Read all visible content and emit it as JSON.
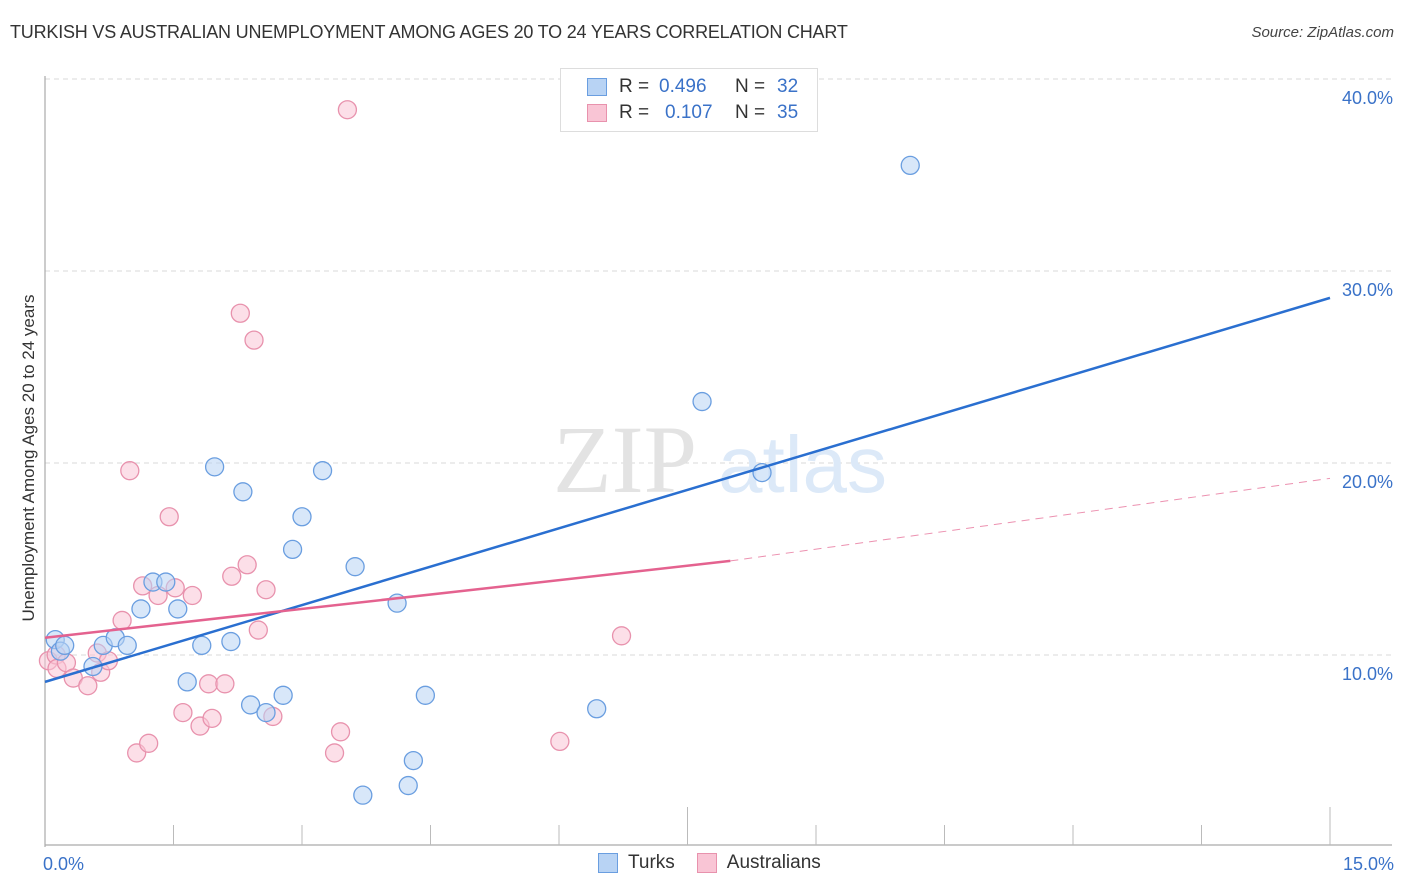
{
  "title": "TURKISH VS AUSTRALIAN UNEMPLOYMENT AMONG AGES 20 TO 24 YEARS CORRELATION CHART",
  "source": "Source: ZipAtlas.com",
  "watermark": {
    "zip": "ZIP",
    "atlas": "atlas"
  },
  "colors": {
    "turks_fill": "#b8d3f4",
    "turks_stroke": "#6a9ee0",
    "turks_line": "#2a6fd0",
    "australians_fill": "#f9c5d5",
    "australians_stroke": "#e892ad",
    "australians_line": "#e4628f",
    "tick_text": "#3a72c8"
  },
  "legend": {
    "rows": [
      {
        "r_label": "R =",
        "r_value": "0.496",
        "n_label": "N =",
        "n_value": "32"
      },
      {
        "r_label": "R =",
        "r_value": "0.107",
        "n_label": "N =",
        "n_value": "35"
      }
    ]
  },
  "bottom_legend": [
    "Turks",
    "Australians"
  ],
  "chart_data": {
    "type": "scatter",
    "title": "TURKISH VS AUSTRALIAN UNEMPLOYMENT AMONG AGES 20 TO 24 YEARS CORRELATION CHART",
    "xlabel": "",
    "ylabel": "Unemployment Among Ages 20 to 24 years",
    "xlim": [
      0,
      15
    ],
    "ylim": [
      0,
      42
    ],
    "x_tick_labels": [
      "0.0%",
      "15.0%"
    ],
    "y_ticks": [
      10,
      20,
      30,
      40
    ],
    "y_tick_labels": [
      "10.0%",
      "20.0%",
      "30.0%",
      "40.0%"
    ],
    "grid": "horizontal-dashed",
    "legend_position": "top-center",
    "series": [
      {
        "name": "Turks",
        "r": 0.496,
        "n": 32,
        "points": [
          [
            0.12,
            10.8
          ],
          [
            0.18,
            10.2
          ],
          [
            0.23,
            10.5
          ],
          [
            0.56,
            9.4
          ],
          [
            0.68,
            10.5
          ],
          [
            0.82,
            10.9
          ],
          [
            0.96,
            10.5
          ],
          [
            1.12,
            12.4
          ],
          [
            1.26,
            13.8
          ],
          [
            1.41,
            13.8
          ],
          [
            1.55,
            12.4
          ],
          [
            1.83,
            10.5
          ],
          [
            1.98,
            19.8
          ],
          [
            1.66,
            8.6
          ],
          [
            2.17,
            10.7
          ],
          [
            2.31,
            18.5
          ],
          [
            2.4,
            7.4
          ],
          [
            2.58,
            7.0
          ],
          [
            2.78,
            7.9
          ],
          [
            2.89,
            15.5
          ],
          [
            3.0,
            17.2
          ],
          [
            3.24,
            19.6
          ],
          [
            3.62,
            14.6
          ],
          [
            3.71,
            2.7
          ],
          [
            4.11,
            12.7
          ],
          [
            4.24,
            3.2
          ],
          [
            4.3,
            4.5
          ],
          [
            4.44,
            7.9
          ],
          [
            6.44,
            7.2
          ],
          [
            7.67,
            23.2
          ],
          [
            8.37,
            19.5
          ],
          [
            10.1,
            35.5
          ]
        ],
        "trend": {
          "x": [
            0,
            15
          ],
          "y": [
            8.6,
            28.6
          ],
          "style": "solid"
        }
      },
      {
        "name": "Australians",
        "r": 0.107,
        "n": 35,
        "points": [
          [
            0.04,
            9.7
          ],
          [
            0.13,
            10.0
          ],
          [
            0.14,
            9.3
          ],
          [
            0.25,
            9.6
          ],
          [
            0.33,
            8.8
          ],
          [
            0.5,
            8.4
          ],
          [
            0.65,
            9.1
          ],
          [
            0.61,
            10.1
          ],
          [
            0.74,
            9.7
          ],
          [
            0.9,
            11.8
          ],
          [
            0.99,
            19.6
          ],
          [
            1.07,
            4.9
          ],
          [
            1.21,
            5.4
          ],
          [
            1.14,
            13.6
          ],
          [
            1.32,
            13.1
          ],
          [
            1.45,
            17.2
          ],
          [
            1.52,
            13.5
          ],
          [
            1.61,
            7.0
          ],
          [
            1.72,
            13.1
          ],
          [
            1.81,
            6.3
          ],
          [
            1.91,
            8.5
          ],
          [
            1.95,
            6.7
          ],
          [
            2.1,
            8.5
          ],
          [
            2.18,
            14.1
          ],
          [
            2.28,
            27.8
          ],
          [
            2.36,
            14.7
          ],
          [
            2.44,
            26.4
          ],
          [
            2.49,
            11.3
          ],
          [
            2.58,
            13.4
          ],
          [
            2.66,
            6.8
          ],
          [
            3.38,
            4.9
          ],
          [
            3.45,
            6.0
          ],
          [
            3.53,
            38.4
          ],
          [
            6.01,
            5.5
          ],
          [
            6.73,
            11.0
          ]
        ],
        "trend": {
          "x": [
            0,
            8.0
          ],
          "y": [
            10.9,
            14.9
          ],
          "style": "solid",
          "extension": {
            "x": [
              8.0,
              15
            ],
            "y": [
              14.9,
              19.2
            ],
            "style": "dashed"
          }
        }
      }
    ]
  }
}
